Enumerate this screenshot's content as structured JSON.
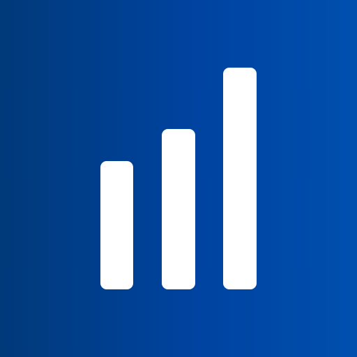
{
  "app_icon": {
    "name": "signal-strength-bars-icon",
    "background_gradient": [
      "#013a7a",
      "#0043a0",
      "#004fae"
    ],
    "bar_color": "#ffffff",
    "bar_levels": [
      0.574,
      0.75,
      0.918
    ]
  }
}
